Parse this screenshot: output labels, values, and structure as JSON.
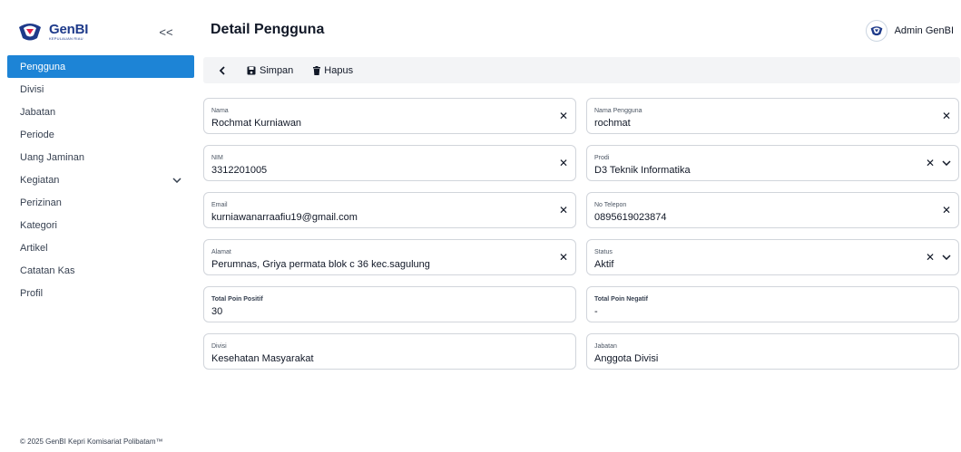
{
  "brand": {
    "name": "GenBI",
    "sub": "KEPULAUAN RIAU"
  },
  "sidebar": {
    "collapse_label": "<<",
    "items": [
      {
        "label": "Pengguna",
        "active": true
      },
      {
        "label": "Divisi"
      },
      {
        "label": "Jabatan"
      },
      {
        "label": "Periode"
      },
      {
        "label": "Uang Jaminan"
      },
      {
        "label": "Kegiatan",
        "expandable": true
      },
      {
        "label": "Perizinan"
      },
      {
        "label": "Kategori"
      },
      {
        "label": "Artikel"
      },
      {
        "label": "Catatan Kas"
      },
      {
        "label": "Profil"
      }
    ],
    "footer": "© 2025 GenBI Kepri Komisariat Polibatam™"
  },
  "header": {
    "title": "Detail Pengguna",
    "user_name": "Admin GenBI"
  },
  "toolbar": {
    "back_label": "<",
    "save_label": "Simpan",
    "delete_label": "Hapus"
  },
  "form": {
    "nama": {
      "label": "Nama",
      "value": "Rochmat Kurniawan"
    },
    "nama_pengguna": {
      "label": "Nama Pengguna",
      "value": "rochmat"
    },
    "nim": {
      "label": "NIM",
      "value": "3312201005"
    },
    "prodi": {
      "label": "Prodi",
      "value": "D3 Teknik Informatika"
    },
    "email": {
      "label": "Email",
      "value": "kurniawanarraafiu19@gmail.com"
    },
    "no_telepon": {
      "label": "No Telepon",
      "value": "0895619023874"
    },
    "alamat": {
      "label": "Alamat",
      "value": "Perumnas, Griya permata blok c 36 kec.sagulung"
    },
    "status": {
      "label": "Status",
      "value": "Aktif"
    },
    "poin_positif": {
      "label": "Total Poin Positif",
      "value": "30"
    },
    "poin_negatif": {
      "label": "Total Poin Negatif",
      "value": "-"
    },
    "divisi": {
      "label": "Divisi",
      "value": "Kesehatan Masyarakat"
    },
    "jabatan": {
      "label": "Jabatan",
      "value": "Anggota Divisi"
    }
  },
  "icons": {
    "clear": "close-icon",
    "dropdown": "chevron-down-icon",
    "save": "save-icon",
    "delete": "trash-icon"
  },
  "colors": {
    "accent": "#1d84d6",
    "brand": "#1e3a8a",
    "toolbar_bg": "#f3f4f6"
  }
}
